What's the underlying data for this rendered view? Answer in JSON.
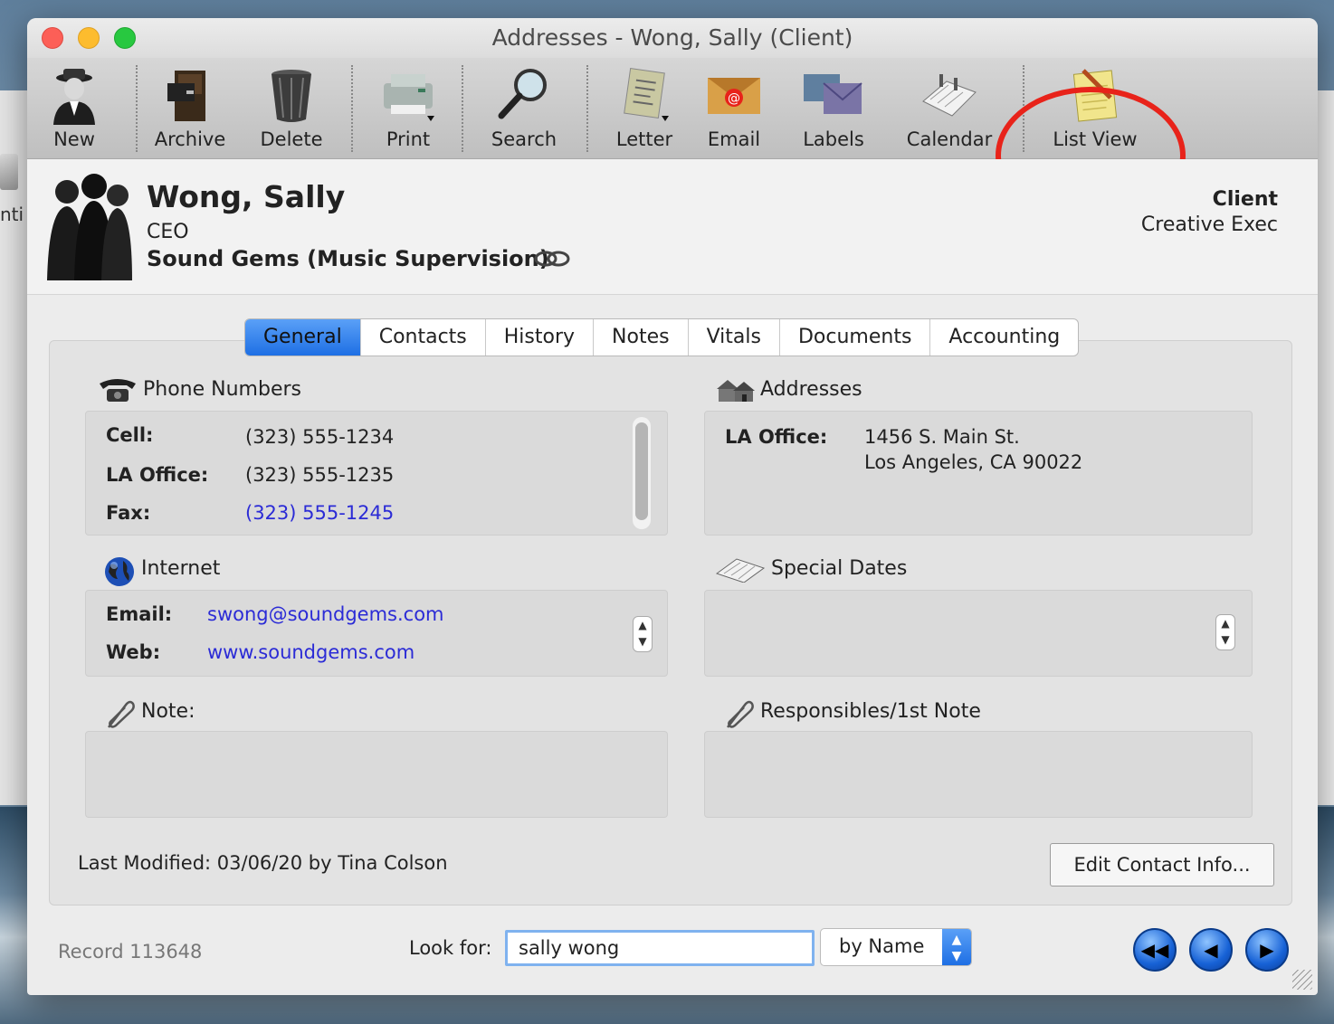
{
  "window": {
    "title": "Addresses - Wong, Sally (Client)"
  },
  "desktop": {
    "peek_text": "nti"
  },
  "toolbar": {
    "new": "New",
    "archive": "Archive",
    "delete": "Delete",
    "print": "Print",
    "search": "Search",
    "letter": "Letter",
    "email": "Email",
    "labels": "Labels",
    "calendar": "Calendar",
    "list_view": "List View",
    "highlight_color": "#e8231a"
  },
  "contact": {
    "name": "Wong, Sally",
    "title": "CEO",
    "company": "Sound Gems (Music Supervision)",
    "type": "Client",
    "subtype": "Creative Exec"
  },
  "tabs": [
    "General",
    "Contacts",
    "History",
    "Notes",
    "Vitals",
    "Documents",
    "Accounting"
  ],
  "active_tab": "General",
  "phones": {
    "heading": "Phone Numbers",
    "rows": [
      {
        "label": "Cell:",
        "value": "(323) 555-1234"
      },
      {
        "label": "LA Office:",
        "value": "(323) 555-1235"
      },
      {
        "label": "Fax:",
        "value": "(323) 555-1245"
      }
    ]
  },
  "addresses": {
    "heading": "Addresses",
    "label": "LA Office:",
    "line1": "1456 S. Main St.",
    "line2": "Los Angeles, CA 90022"
  },
  "internet": {
    "heading": "Internet",
    "email_label": "Email:",
    "email": "swong@soundgems.com",
    "web_label": "Web:",
    "web": "www.soundgems.com"
  },
  "special_dates": {
    "heading": "Special Dates"
  },
  "note": {
    "heading": "Note:"
  },
  "responsibles": {
    "heading": "Responsibles/1st Note"
  },
  "footer": {
    "last_modified": "Last Modified: 03/06/20 by Tina Colson",
    "edit_button": "Edit Contact Info...",
    "record": "Record 113648",
    "look_for_label": "Look for:",
    "look_for_value": "sally wong",
    "by_select": "by Name"
  },
  "colors": {
    "accent": "#1e6fe4",
    "link": "#2b2bd6"
  }
}
